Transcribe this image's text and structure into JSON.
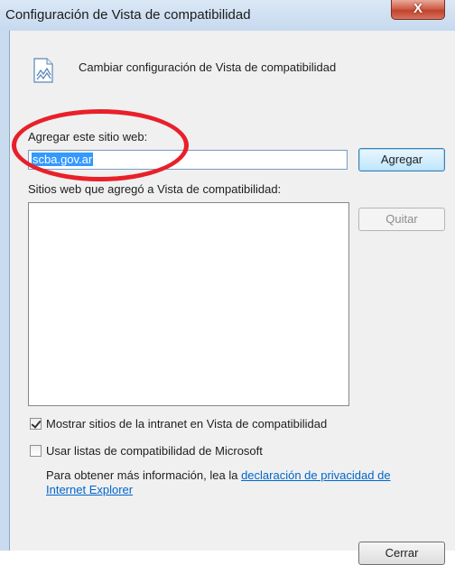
{
  "window": {
    "title": "Configuración de Vista de compatibilidad",
    "close_glyph": "X"
  },
  "header": {
    "icon": "document-compat-icon",
    "text": "Cambiar configuración de Vista de compatibilidad"
  },
  "add_site": {
    "label": "Agregar este sitio web:",
    "value": "scba.gov.ar",
    "button_label": "Agregar"
  },
  "sites_list": {
    "label": "Sitios web que agregó a Vista de compatibilidad:",
    "items": [],
    "remove_label": "Quitar"
  },
  "options": {
    "intranet_label": "Mostrar sitios de la intranet en Vista de compatibilidad",
    "intranet_checked": true,
    "ms_lists_label": "Usar listas de compatibilidad de Microsoft",
    "ms_lists_checked": false
  },
  "info": {
    "text": "Para obtener más información, lea la ",
    "link_part1": "declaración de privacidad de",
    "link_part2": "Internet Explorer"
  },
  "footer": {
    "close_label": "Cerrar"
  },
  "colors": {
    "highlight_ring": "#e8202a",
    "link": "#0066cc",
    "titlebar": "#c9dbee"
  }
}
